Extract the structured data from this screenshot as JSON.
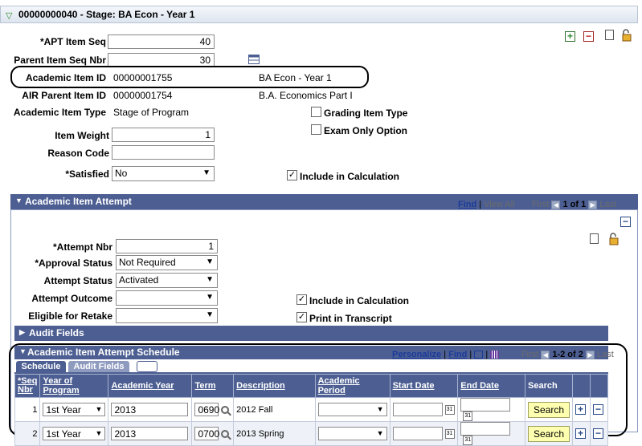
{
  "header": {
    "title": "00000000040 - Stage: BA Econ - Year 1"
  },
  "fields": {
    "apt_item_seq_label": "*APT Item Seq",
    "apt_item_seq_value": "40",
    "parent_item_seq_label": "Parent Item Seq Nbr",
    "parent_item_seq_value": "30",
    "academic_item_id_label": "Academic Item ID",
    "academic_item_id_value": "00000001755",
    "academic_item_desc": "BA Econ - Year 1",
    "air_parent_item_id_label": "AIR Parent Item ID",
    "air_parent_item_id_value": "00000001754",
    "air_parent_item_desc": "B.A. Economics Part I",
    "academic_item_type_label": "Academic Item Type",
    "academic_item_type_value": "Stage of Program",
    "grading_item_type_label": "Grading Item Type",
    "exam_only_option_label": "Exam Only Option",
    "item_weight_label": "Item Weight",
    "item_weight_value": "1",
    "reason_code_label": "Reason Code",
    "reason_code_value": "",
    "satisfied_label": "*Satisfied",
    "satisfied_value": "No",
    "include_in_calc_label": "Include in Calculation"
  },
  "attempt": {
    "section_title": "Academic Item Attempt",
    "nav_find": "Find",
    "nav_view_all": "View All",
    "nav_first": "First",
    "nav_count": "1 of 1",
    "nav_last": "Last",
    "attempt_nbr_label": "*Attempt Nbr",
    "attempt_nbr_value": "1",
    "approval_status_label": "*Approval Status",
    "approval_status_value": "Not Required",
    "attempt_status_label": "Attempt Status",
    "attempt_status_value": "Activated",
    "attempt_outcome_label": "Attempt Outcome",
    "attempt_outcome_value": "",
    "eligible_retake_label": "Eligible for Retake",
    "eligible_retake_value": "",
    "include_in_calc_label": "Include in Calculation",
    "print_in_transcript_label": "Print in Transcript",
    "audit_fields_label": "Audit Fields"
  },
  "schedule": {
    "section_title": "Academic Item Attempt Schedule",
    "nav_personalize": "Personalize",
    "nav_find": "Find",
    "nav_first": "First",
    "nav_count": "1-2 of 2",
    "nav_last": "Last",
    "tabs": [
      "Schedule",
      "Audit Fields"
    ],
    "columns": {
      "seq_nbr_1": "*Seq",
      "seq_nbr_2": "Nbr",
      "year_of_program": "Year of Program",
      "academic_year": "Academic Year",
      "term": "Term",
      "description": "Description",
      "academic_period": "Academic Period",
      "start_date": "Start Date",
      "end_date": "End Date",
      "search": "Search"
    },
    "rows": [
      {
        "seq": "1",
        "year_of_program": "1st Year",
        "academic_year": "2013",
        "term": "0690",
        "description": "2012 Fall",
        "academic_period": "",
        "start_date": "",
        "end_date": "",
        "search": "Search"
      },
      {
        "seq": "2",
        "year_of_program": "1st Year",
        "academic_year": "2013",
        "term": "0700",
        "description": "2013 Spring",
        "academic_period": "",
        "start_date": "",
        "end_date": "",
        "search": "Search"
      }
    ]
  }
}
